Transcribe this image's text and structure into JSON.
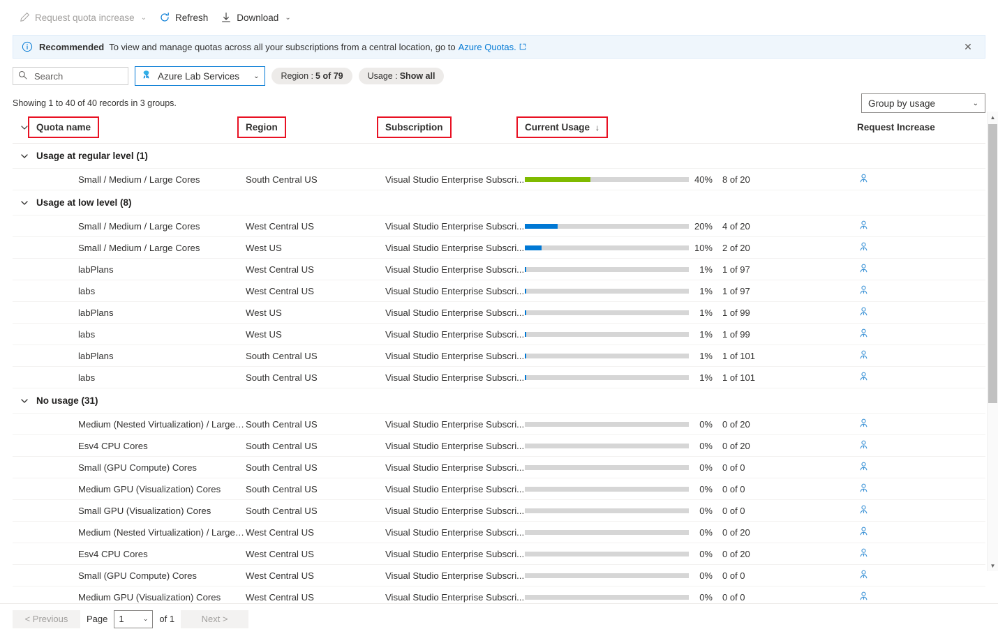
{
  "toolbar": {
    "items": [
      {
        "label": "Request quota increase",
        "icon": "pencil-icon",
        "caret": true,
        "disabled": true
      },
      {
        "label": "Refresh",
        "icon": "refresh-icon",
        "caret": false,
        "disabled": false
      },
      {
        "label": "Download",
        "icon": "download-icon",
        "caret": true,
        "disabled": false
      }
    ]
  },
  "banner": {
    "icon": "info-icon",
    "strong": "Recommended",
    "text": "To view and manage quotas across all your subscriptions from a central location, go to",
    "link": "Azure Quotas.",
    "link_icon": "external-link-icon",
    "close_icon": "close-icon",
    "accent": "#0078d4",
    "background": "#eff6fc"
  },
  "filters": {
    "search_placeholder": "Search",
    "search_value": "",
    "search_icon": "search-icon",
    "provider": "Azure Lab Services",
    "provider_icon": "azure-lab-services-icon",
    "pills": [
      {
        "label": "Region :",
        "value": "5 of 79"
      },
      {
        "label": "Usage :",
        "value": "Show all"
      }
    ]
  },
  "summary": {
    "records_text": "Showing 1 to 40 of 40 records in 3 groups.",
    "group_by": "Group by usage"
  },
  "table": {
    "columns": [
      {
        "key": "quota",
        "label": "Quota name",
        "highlighted": true
      },
      {
        "key": "region",
        "label": "Region",
        "highlighted": true
      },
      {
        "key": "subscription",
        "label": "Subscription",
        "highlighted": true
      },
      {
        "key": "usage",
        "label": "Current Usage",
        "highlighted": true,
        "sort": "↓"
      },
      {
        "key": "request",
        "label": "Request Increase",
        "highlighted": false
      }
    ],
    "colors": {
      "regular": "#7fba00",
      "low": "#0078d4",
      "track": "#d6d6d6",
      "person": "#3b92d6"
    },
    "groups": [
      {
        "title": "Usage at regular level (1)",
        "level": "regular",
        "rows": [
          {
            "quota": "Small / Medium / Large Cores",
            "region": "South Central US",
            "subscription": "Visual Studio Enterprise Subscri...",
            "pct": 40,
            "pct_label": "40%",
            "quantity": "8 of 20",
            "bar_color": "#7fba00",
            "request_icon": "person-icon"
          }
        ]
      },
      {
        "title": "Usage at low level (8)",
        "level": "low",
        "rows": [
          {
            "quota": "Small / Medium / Large Cores",
            "region": "West Central US",
            "subscription": "Visual Studio Enterprise Subscri...",
            "pct": 20,
            "pct_label": "20%",
            "quantity": "4 of 20",
            "bar_color": "#0078d4",
            "request_icon": "person-icon"
          },
          {
            "quota": "Small / Medium / Large Cores",
            "region": "West US",
            "subscription": "Visual Studio Enterprise Subscri...",
            "pct": 10,
            "pct_label": "10%",
            "quantity": "2 of 20",
            "bar_color": "#0078d4",
            "request_icon": "person-icon"
          },
          {
            "quota": "labPlans",
            "region": "West Central US",
            "subscription": "Visual Studio Enterprise Subscri...",
            "pct": 1,
            "pct_label": "1%",
            "quantity": "1 of 97",
            "bar_color": "#0078d4",
            "request_icon": "person-icon"
          },
          {
            "quota": "labs",
            "region": "West Central US",
            "subscription": "Visual Studio Enterprise Subscri...",
            "pct": 1,
            "pct_label": "1%",
            "quantity": "1 of 97",
            "bar_color": "#0078d4",
            "request_icon": "person-icon"
          },
          {
            "quota": "labPlans",
            "region": "West US",
            "subscription": "Visual Studio Enterprise Subscri...",
            "pct": 1,
            "pct_label": "1%",
            "quantity": "1 of 99",
            "bar_color": "#0078d4",
            "request_icon": "person-icon"
          },
          {
            "quota": "labs",
            "region": "West US",
            "subscription": "Visual Studio Enterprise Subscri...",
            "pct": 1,
            "pct_label": "1%",
            "quantity": "1 of 99",
            "bar_color": "#0078d4",
            "request_icon": "person-icon"
          },
          {
            "quota": "labPlans",
            "region": "South Central US",
            "subscription": "Visual Studio Enterprise Subscri...",
            "pct": 1,
            "pct_label": "1%",
            "quantity": "1 of 101",
            "bar_color": "#0078d4",
            "request_icon": "person-icon"
          },
          {
            "quota": "labs",
            "region": "South Central US",
            "subscription": "Visual Studio Enterprise Subscri...",
            "pct": 1,
            "pct_label": "1%",
            "quantity": "1 of 101",
            "bar_color": "#0078d4",
            "request_icon": "person-icon"
          }
        ]
      },
      {
        "title": "No usage (31)",
        "level": "none",
        "rows": [
          {
            "quota": "Medium (Nested Virtualization) / Large (Nested ...",
            "region": "South Central US",
            "subscription": "Visual Studio Enterprise Subscri...",
            "pct": 0,
            "pct_label": "0%",
            "quantity": "0 of 20",
            "bar_color": "#d6d6d6",
            "request_icon": "person-icon"
          },
          {
            "quota": "Esv4 CPU Cores",
            "region": "South Central US",
            "subscription": "Visual Studio Enterprise Subscri...",
            "pct": 0,
            "pct_label": "0%",
            "quantity": "0 of 20",
            "bar_color": "#d6d6d6",
            "request_icon": "person-icon"
          },
          {
            "quota": "Small (GPU Compute) Cores",
            "region": "South Central US",
            "subscription": "Visual Studio Enterprise Subscri...",
            "pct": 0,
            "pct_label": "0%",
            "quantity": "0 of 0",
            "bar_color": "#d6d6d6",
            "request_icon": "person-icon"
          },
          {
            "quota": "Medium GPU (Visualization) Cores",
            "region": "South Central US",
            "subscription": "Visual Studio Enterprise Subscri...",
            "pct": 0,
            "pct_label": "0%",
            "quantity": "0 of 0",
            "bar_color": "#d6d6d6",
            "request_icon": "person-icon"
          },
          {
            "quota": "Small GPU (Visualization) Cores",
            "region": "South Central US",
            "subscription": "Visual Studio Enterprise Subscri...",
            "pct": 0,
            "pct_label": "0%",
            "quantity": "0 of 0",
            "bar_color": "#d6d6d6",
            "request_icon": "person-icon"
          },
          {
            "quota": "Medium (Nested Virtualization) / Large (Nested ...",
            "region": "West Central US",
            "subscription": "Visual Studio Enterprise Subscri...",
            "pct": 0,
            "pct_label": "0%",
            "quantity": "0 of 20",
            "bar_color": "#d6d6d6",
            "request_icon": "person-icon"
          },
          {
            "quota": "Esv4 CPU Cores",
            "region": "West Central US",
            "subscription": "Visual Studio Enterprise Subscri...",
            "pct": 0,
            "pct_label": "0%",
            "quantity": "0 of 20",
            "bar_color": "#d6d6d6",
            "request_icon": "person-icon"
          },
          {
            "quota": "Small (GPU Compute) Cores",
            "region": "West Central US",
            "subscription": "Visual Studio Enterprise Subscri...",
            "pct": 0,
            "pct_label": "0%",
            "quantity": "0 of 0",
            "bar_color": "#d6d6d6",
            "request_icon": "person-icon"
          },
          {
            "quota": "Medium GPU (Visualization) Cores",
            "region": "West Central US",
            "subscription": "Visual Studio Enterprise Subscri...",
            "pct": 0,
            "pct_label": "0%",
            "quantity": "0 of 0",
            "bar_color": "#d6d6d6",
            "request_icon": "person-icon"
          }
        ]
      }
    ]
  },
  "pager": {
    "previous": "< Previous",
    "page_label": "Page",
    "page_value": "1",
    "of_label": "of 1",
    "next": "Next >"
  }
}
